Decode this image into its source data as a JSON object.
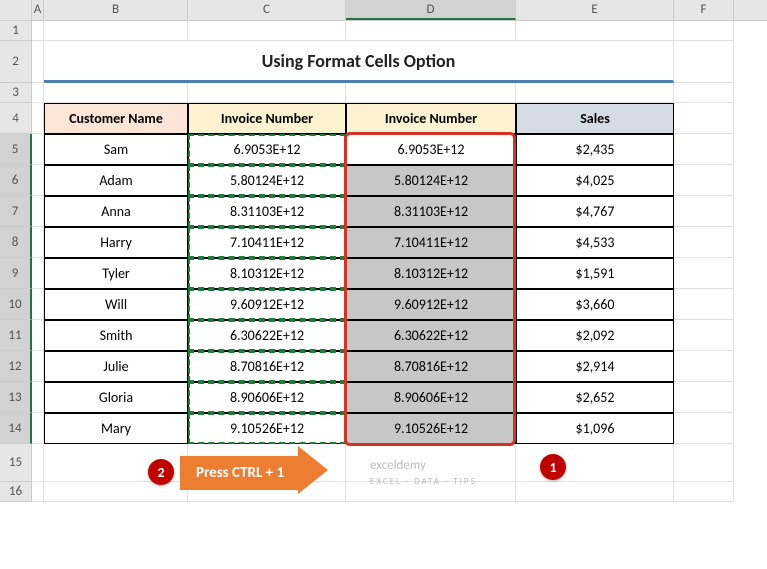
{
  "columns": [
    "A",
    "B",
    "C",
    "D",
    "E",
    "F"
  ],
  "title": "Using Format Cells Option",
  "headers": {
    "b": "Customer Name",
    "c": "Invoice Number",
    "d": "Invoice Number",
    "e": "Sales"
  },
  "rows": [
    {
      "name": "Sam",
      "invC": "6.9053E+12",
      "invD": "6.9053E+12",
      "sales": "$2,435"
    },
    {
      "name": "Adam",
      "invC": "5.80124E+12",
      "invD": "5.80124E+12",
      "sales": "$4,025"
    },
    {
      "name": "Anna",
      "invC": "8.31103E+12",
      "invD": "8.31103E+12",
      "sales": "$4,767"
    },
    {
      "name": "Harry",
      "invC": "7.10411E+12",
      "invD": "7.10411E+12",
      "sales": "$4,533"
    },
    {
      "name": "Tyler",
      "invC": "8.10312E+12",
      "invD": "8.10312E+12",
      "sales": "$1,591"
    },
    {
      "name": "Will",
      "invC": "9.60912E+12",
      "invD": "9.60912E+12",
      "sales": "$3,660"
    },
    {
      "name": "Smith",
      "invC": "6.30622E+12",
      "invD": "6.30622E+12",
      "sales": "$2,092"
    },
    {
      "name": "Julie",
      "invC": "8.70816E+12",
      "invD": "8.70816E+12",
      "sales": "$2,914"
    },
    {
      "name": "Gloria",
      "invC": "8.90606E+12",
      "invD": "8.90606E+12",
      "sales": "$2,652"
    },
    {
      "name": "Mary",
      "invC": "9.10526E+12",
      "invD": "9.10526E+12",
      "sales": "$1,096"
    }
  ],
  "badges": {
    "one": "1",
    "two": "2"
  },
  "callout": "Press CTRL + 1",
  "watermark": {
    "main": "exceldemy",
    "sub": "EXCEL · DATA · TIPS"
  }
}
